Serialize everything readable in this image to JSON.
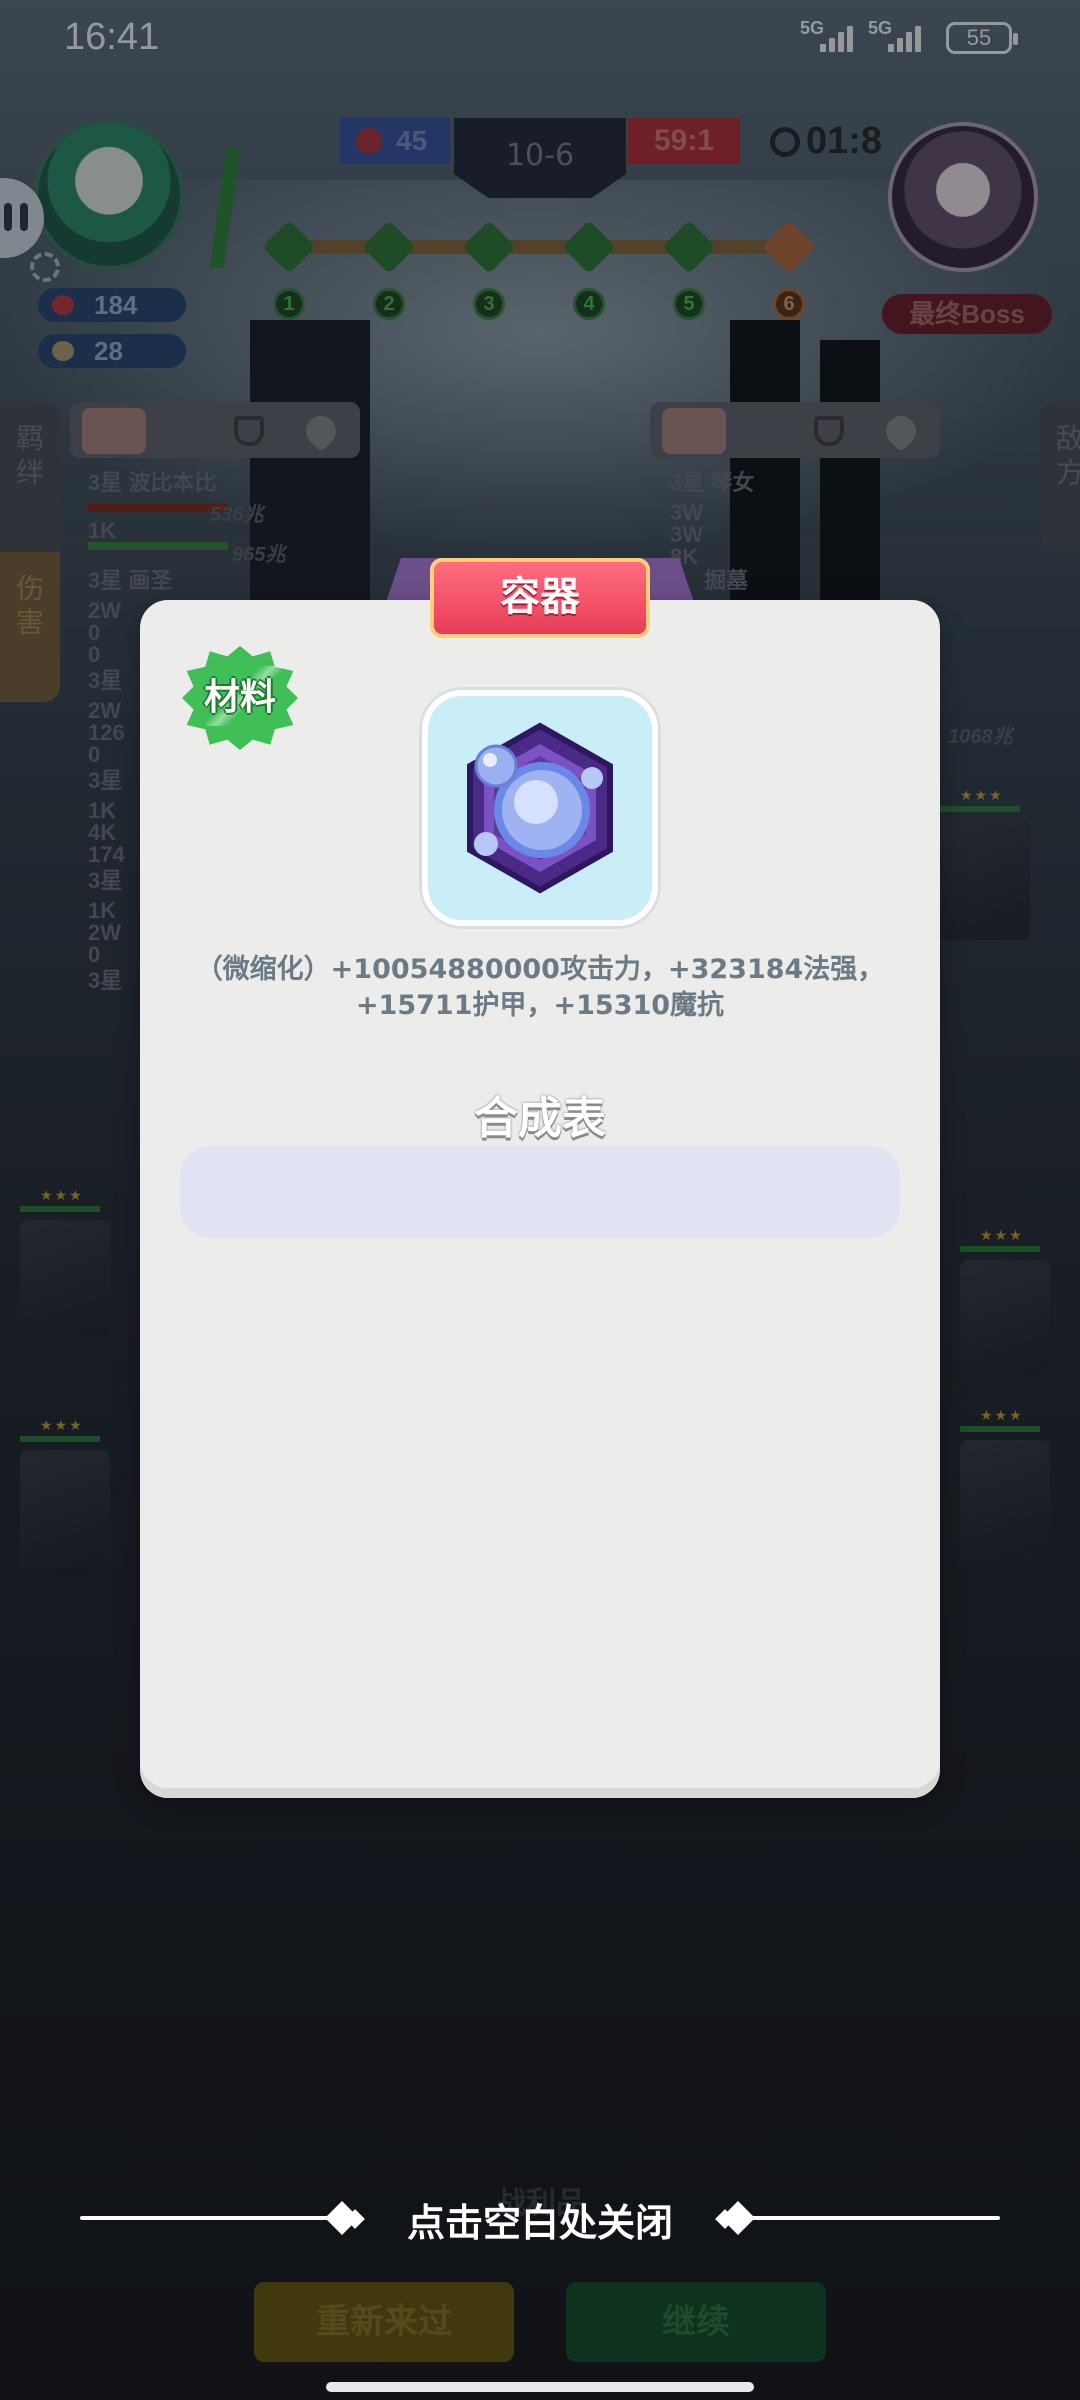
{
  "status_bar": {
    "time": "16:41",
    "signal_1": "5G",
    "signal_2": "5G",
    "battery": "55"
  },
  "hud": {
    "player_hp": "184",
    "player_coins": "28",
    "score_left": "45",
    "stage": "10-6",
    "score_right": "59:1",
    "timer": "01:8",
    "boss_label": "最终Boss",
    "waves": [
      "1",
      "2",
      "3",
      "4",
      "5",
      "6"
    ]
  },
  "side_tabs": {
    "bonds": "羁\n绊",
    "damage": "伤\n害",
    "enemy": "敌\n方"
  },
  "left_roster": {
    "r1_name": "3星 波比本比",
    "r1_val_a": "536兆",
    "r1_val_b": "1K",
    "r1_val_c": "965兆",
    "r2_name": "3星 画圣",
    "r2_vals": "2W\n0\n0",
    "r3_name": "3星",
    "r3_vals": "2W\n126\n0",
    "r4_name": "3星",
    "r4_vals": "1K\n4K\n174",
    "r5_name": "3星",
    "r5_vals": "1K\n2W\n0",
    "r6_name": "3星"
  },
  "right_roster": {
    "r1_name": "3星 琴女",
    "r1_vals": "3W\n3W\n8K",
    "r2_name": "掘墓",
    "r3_val": "1068兆"
  },
  "modal": {
    "title": "容器",
    "badge": "材料",
    "description_line1": "（微缩化）+10054880000攻击力，+323184法强，",
    "description_line2": "+15711护甲，+15310魔抗",
    "synthesis_title": "合成表"
  },
  "footer": {
    "close_hint": "点击空白处关闭",
    "battle_stats": "战利品",
    "restart": "重新来过",
    "continue": "继续"
  },
  "colors": {
    "modal_bg": "#ececea",
    "title_ribbon": "#e73d57",
    "badge_green": "#3fbf55",
    "icon_bg": "#c9eef8",
    "synthesis_list_bg": "#e0e3f2"
  }
}
